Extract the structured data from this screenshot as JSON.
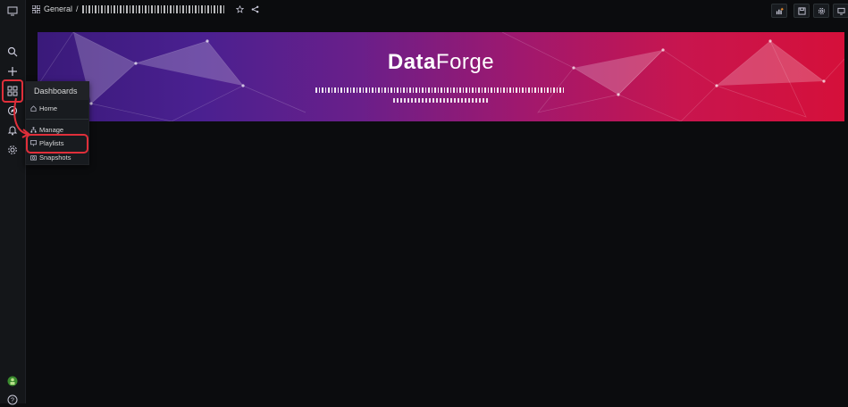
{
  "app": {
    "accent": "#e02f3a"
  },
  "sidebar": {
    "top_icon": "monitor-icon",
    "icons": [
      "search-icon",
      "plus-icon",
      "dashboards-icon",
      "explore-icon",
      "alert-bell-icon",
      "gear-icon"
    ],
    "bottom_icons": [
      "avatar",
      "help-icon"
    ]
  },
  "breadcrumb": {
    "folder": "General",
    "separator": "/"
  },
  "topbar": {
    "buttons": [
      "add-panel-icon",
      "save-icon",
      "settings-icon",
      "tv-mode-icon"
    ]
  },
  "banner": {
    "brand_bold": "Data",
    "brand_light": "Forge"
  },
  "flyout": {
    "title": "Dashboards",
    "items": [
      {
        "label": "Home",
        "icon": "home-icon"
      },
      {
        "label": "Manage",
        "icon": "sitemap-icon"
      },
      {
        "label": "Playlists",
        "icon": "playlist-icon"
      },
      {
        "label": "Snapshots",
        "icon": "camera-icon"
      }
    ]
  }
}
